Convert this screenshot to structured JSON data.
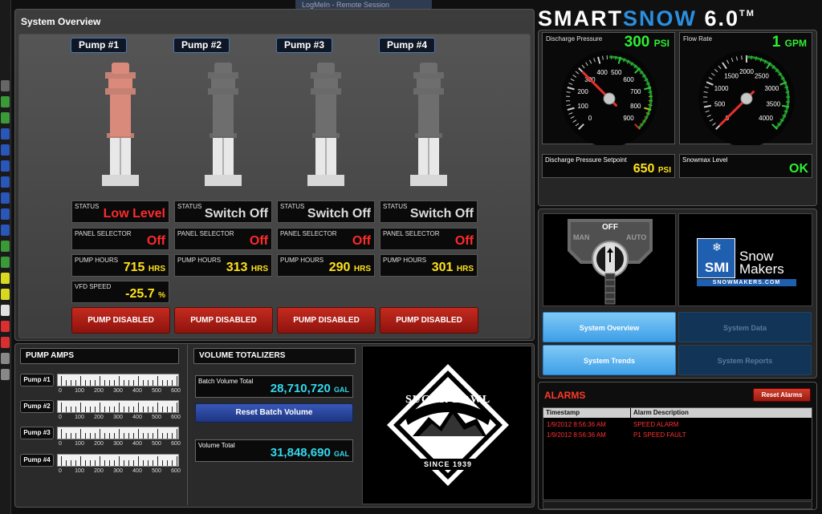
{
  "remote_session": {
    "title": "LogMeIn - Remote Session"
  },
  "overview": {
    "title": "System Overview",
    "pumps": [
      {
        "label": "Pump #1",
        "status": "Low Level",
        "panel_selector": "Off",
        "hours": "715",
        "hours_unit": "HRS",
        "button": "PUMP DISABLED",
        "graphic_color": "#d98a7a"
      },
      {
        "label": "Pump #2",
        "status": "Switch Off",
        "panel_selector": "Off",
        "hours": "313",
        "hours_unit": "HRS",
        "button": "PUMP DISABLED",
        "graphic_color": "#6e6e6e"
      },
      {
        "label": "Pump #3",
        "status": "Switch Off",
        "panel_selector": "Off",
        "hours": "290",
        "hours_unit": "HRS",
        "button": "PUMP DISABLED",
        "graphic_color": "#6e6e6e"
      },
      {
        "label": "Pump #4",
        "status": "Switch Off",
        "panel_selector": "Off",
        "hours": "301",
        "hours_unit": "HRS",
        "button": "PUMP DISABLED",
        "graphic_color": "#6e6e6e"
      }
    ],
    "labels": {
      "status": "STATUS",
      "panel_selector": "PANEL SELECTOR",
      "pump_hours": "PUMP HOURS",
      "vfd_speed": "VFD SPEED"
    },
    "vfd_speed": {
      "value": "-25.7",
      "unit": "%"
    }
  },
  "pump_amps": {
    "title": "PUMP AMPS",
    "scale": [
      "0",
      "100",
      "200",
      "300",
      "400",
      "500",
      "600"
    ],
    "rows": [
      {
        "label": "Pump #1",
        "value": 0
      },
      {
        "label": "Pump #2",
        "value": 0
      },
      {
        "label": "Pump #3",
        "value": 0
      },
      {
        "label": "Pump #4",
        "value": 0
      }
    ]
  },
  "volume": {
    "title": "VOLUME TOTALIZERS",
    "batch_label": "Batch Volume Total",
    "batch_value": "28,710,720",
    "batch_unit": "GAL",
    "reset_button": "Reset Batch Volume",
    "total_label": "Volume Total",
    "total_value": "31,848,690",
    "total_unit": "GAL"
  },
  "logo": {
    "name": "SUGAR BOWL",
    "since": "SINCE 1939"
  },
  "brand": {
    "part1": "SMART",
    "part2": "SNOW",
    "version": " 6.0",
    "tm": "TM"
  },
  "gauges": {
    "discharge": {
      "label": "Discharge Pressure",
      "value": "300",
      "unit": "PSI",
      "needle_value": 300,
      "min": 0,
      "max": 900,
      "ticks": [
        "0",
        "100",
        "200",
        "300",
        "400",
        "500",
        "600",
        "700",
        "800",
        "900"
      ]
    },
    "flow": {
      "label": "Flow Rate",
      "value": "1",
      "unit": "GPM",
      "needle_value": 1,
      "min": 0,
      "max": 4000,
      "ticks": [
        "0",
        "500",
        "1000",
        "1500",
        "2000",
        "2500",
        "3000",
        "3500",
        "4000"
      ]
    }
  },
  "setpoint": {
    "label": "Discharge Pressure Setpoint",
    "value": "650",
    "unit": "PSI"
  },
  "snowmax": {
    "label": "Snowmax Level",
    "value": "OK"
  },
  "mode_switch": {
    "off": "OFF",
    "man": "MAN",
    "auto": "AUTO"
  },
  "smi_logo": {
    "mark": "SMI",
    "line1": "Snow",
    "line2": "Makers",
    "url": "SNOWMAKERS.COM"
  },
  "nav": {
    "overview": "System Overview",
    "data": "System Data",
    "trends": "System Trends",
    "reports": "System Reports"
  },
  "alarms": {
    "title": "ALARMS",
    "reset_button": "Reset Alarms",
    "headers": [
      "Timestamp",
      "Alarm Description"
    ],
    "rows": [
      [
        "1/9/2012 8:56:36 AM",
        "SPEED ALARM"
      ],
      [
        "1/9/2012 8:56:36 AM",
        "P1 SPEED FAULT"
      ]
    ]
  },
  "colors": {
    "accent_blue": "#2b8fe0",
    "alarm_red": "#ff2a2a",
    "value_yellow": "#ffe11a",
    "value_green": "#2ef032",
    "value_cyan": "#34d8ec"
  }
}
